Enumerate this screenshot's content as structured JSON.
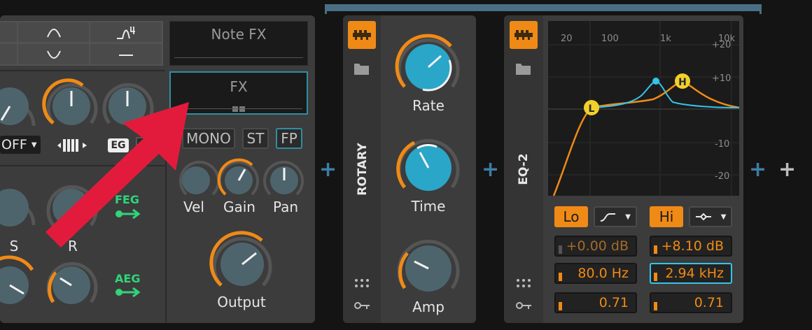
{
  "note_fx": {
    "label": "Note FX"
  },
  "fx": {
    "label": "FX"
  },
  "synth": {
    "mode_select": "OFF",
    "eg_label": "EG",
    "buttons": {
      "mono": "MONO",
      "st": "ST",
      "fp": "FP"
    },
    "knobs": {
      "vel": "Vel",
      "gain": "Gain",
      "pan": "Pan",
      "output": "Output",
      "s": "S",
      "r": "R"
    },
    "feg": "FEG",
    "aeg": "AEG"
  },
  "rotary": {
    "title": "ROTARY",
    "knobs": {
      "rate": "Rate",
      "time": "Time",
      "amp": "Amp"
    }
  },
  "eq2": {
    "title": "EQ-2",
    "freq_labels": [
      "20",
      "100",
      "1k",
      "10k"
    ],
    "db_labels": [
      "+20",
      "+10",
      "-10",
      "-20"
    ],
    "nodes": {
      "low": "L",
      "high": "H"
    },
    "lo_label": "Lo",
    "hi_label": "Hi",
    "lo_gain": "+0.00 dB",
    "hi_gain": "+8.10 dB",
    "lo_freq": "80.0 Hz",
    "hi_freq": "2.94 kHz",
    "lo_q": "0.71",
    "hi_q": "0.71"
  },
  "colors": {
    "accent": "#f08a16",
    "teal": "#37c3e8",
    "arrow": "#e21b3c",
    "header_bar": "#4a6f85",
    "node": "#f2d02a"
  }
}
